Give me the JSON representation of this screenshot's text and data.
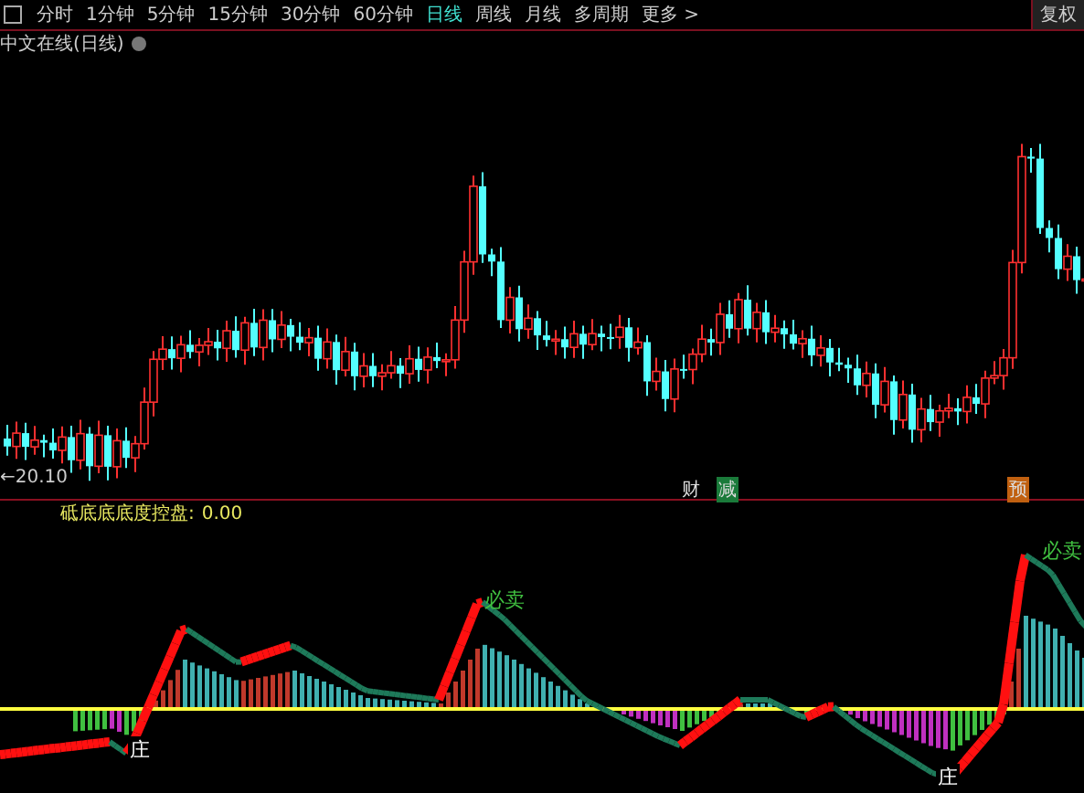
{
  "toolbar": {
    "tabs": [
      {
        "label": "分时",
        "selected": false
      },
      {
        "label": "1分钟",
        "selected": false
      },
      {
        "label": "5分钟",
        "selected": false
      },
      {
        "label": "15分钟",
        "selected": false
      },
      {
        "label": "30分钟",
        "selected": false
      },
      {
        "label": "60分钟",
        "selected": false
      },
      {
        "label": "日线",
        "selected": true
      },
      {
        "label": "周线",
        "selected": false
      },
      {
        "label": "月线",
        "selected": false
      },
      {
        "label": "多周期",
        "selected": false
      },
      {
        "label": "更多 >",
        "selected": false
      }
    ],
    "restore_button": "复权"
  },
  "chart_title": "中文在线(日线)",
  "price_chart": {
    "low_label": "←20.10",
    "markers": [
      {
        "label": "财",
        "kind": "plain"
      },
      {
        "label": "减",
        "kind": "green"
      },
      {
        "label": "预",
        "kind": "orange"
      }
    ]
  },
  "indicator": {
    "name": "砥底底底度控盘:",
    "value": "0.00",
    "signals": [
      {
        "label": "必卖",
        "kind": "sell"
      },
      {
        "label": "必卖",
        "kind": "sell"
      },
      {
        "label": "庄",
        "kind": "buy"
      },
      {
        "label": "庄",
        "kind": "buy"
      }
    ]
  }
}
